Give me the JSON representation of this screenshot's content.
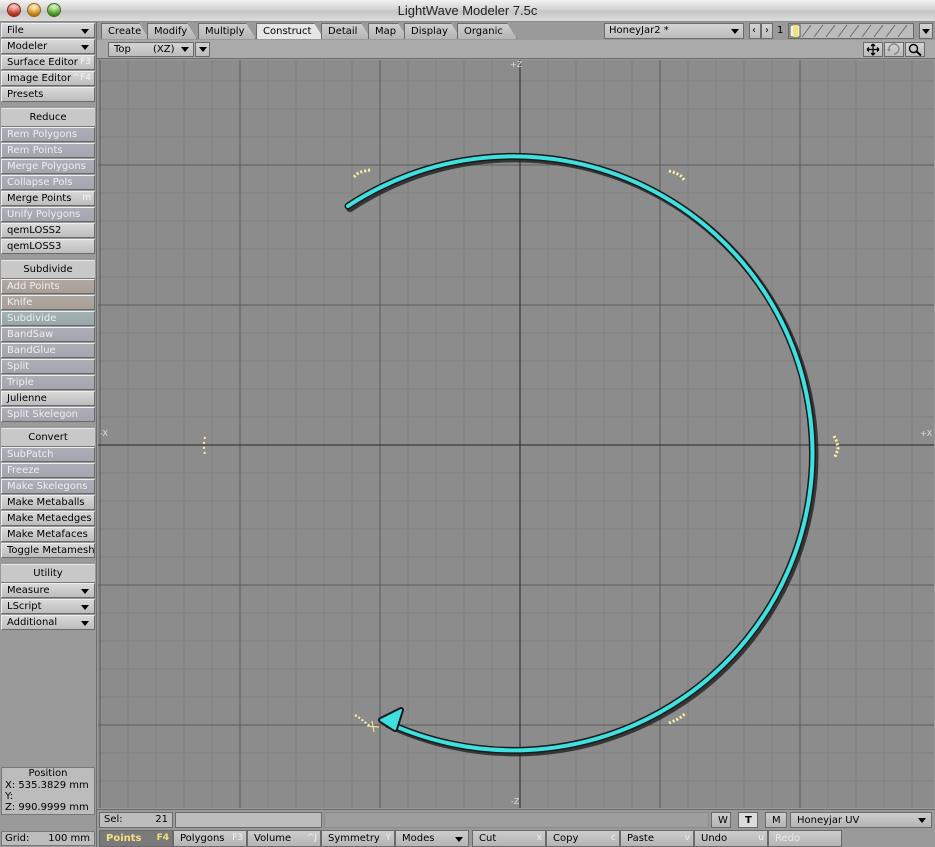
{
  "window": {
    "title": "LightWave Modeler 7.5c"
  },
  "left_panel": {
    "menus": [
      {
        "label": "File"
      },
      {
        "label": "Modeler"
      }
    ],
    "editors": [
      {
        "label": "Surface Editor",
        "key": "F3"
      },
      {
        "label": "Image Editor",
        "key": "^F4"
      },
      {
        "label": "Presets",
        "key": ""
      }
    ],
    "reduce": {
      "header": "Reduce",
      "items": [
        {
          "label": "Rem Polygons",
          "enabled": false
        },
        {
          "label": "Rem Points",
          "enabled": false
        },
        {
          "label": "Merge Polygons",
          "enabled": false
        },
        {
          "label": "Collapse Pols",
          "enabled": false
        },
        {
          "label": "Merge Points",
          "enabled": true,
          "key": "m"
        },
        {
          "label": "Unify Polygons",
          "enabled": false
        },
        {
          "label": "qemLOSS2",
          "enabled": true
        },
        {
          "label": "qemLOSS3",
          "enabled": true
        }
      ]
    },
    "subdivide": {
      "header": "Subdivide",
      "items": [
        {
          "label": "Add Points",
          "enabled": false
        },
        {
          "label": "Knife",
          "enabled": false
        },
        {
          "label": "Subdivide",
          "enabled": false
        },
        {
          "label": "BandSaw",
          "enabled": false
        },
        {
          "label": "BandGlue",
          "enabled": false
        },
        {
          "label": "Split",
          "enabled": false
        },
        {
          "label": "Triple",
          "enabled": false
        },
        {
          "label": "Julienne",
          "enabled": true
        },
        {
          "label": "Split Skelegon",
          "enabled": false
        }
      ]
    },
    "convert": {
      "header": "Convert",
      "items": [
        {
          "label": "SubPatch",
          "enabled": false
        },
        {
          "label": "Freeze",
          "enabled": false
        },
        {
          "label": "Make Skelegons",
          "enabled": false
        },
        {
          "label": "Make Metaballs",
          "enabled": true
        },
        {
          "label": "Make Metaedges",
          "enabled": true
        },
        {
          "label": "Make Metafaces",
          "enabled": true
        },
        {
          "label": "Toggle Metamesh",
          "enabled": true
        }
      ]
    },
    "utility": {
      "header": "Utility",
      "items": [
        {
          "label": "Measure"
        },
        {
          "label": "LScript"
        },
        {
          "label": "Additional"
        }
      ]
    },
    "position": {
      "header": "Position",
      "x": "X:  535.3829 mm",
      "y": "Y:",
      "z": "Z:  990.9999 mm"
    },
    "grid": {
      "label": "Grid:",
      "value": "100 mm"
    }
  },
  "tabs": [
    "Create",
    "Modify",
    "Multiply",
    "Construct",
    "Detail",
    "Map",
    "Display",
    "Organic"
  ],
  "active_tab": "Construct",
  "object": {
    "name": "HoneyJar2 *",
    "layer_number": "1"
  },
  "viewport": {
    "view": "Top",
    "axes": "(XZ)",
    "labels": {
      "plus_z": "+Z",
      "minus_z": "-Z",
      "minus_x": "-X",
      "plus_x": "+X"
    },
    "colors": {
      "arrow": "#3ee0e0",
      "points": "#fff0a0",
      "grid": "#7c7c7c",
      "axis": "#222222"
    }
  },
  "selection": {
    "label": "Sel:",
    "count": "21"
  },
  "wtm": {
    "w": "W",
    "t": "T",
    "m": "M",
    "active": "T"
  },
  "uv_map": "Honeyjar UV",
  "modes": [
    {
      "label": "Points",
      "key": "F4",
      "active": true
    },
    {
      "label": "Polygons",
      "key": "F3"
    },
    {
      "label": "Volume",
      "key": "^J"
    },
    {
      "label": "Symmetry",
      "key": "Y"
    },
    {
      "label": "Modes",
      "dropdown": true
    },
    {
      "label": "Cut",
      "key": "x"
    },
    {
      "label": "Copy",
      "key": "c"
    },
    {
      "label": "Paste",
      "key": "v"
    },
    {
      "label": "Undo",
      "key": "u"
    },
    {
      "label": "Redo",
      "key": ""
    }
  ]
}
